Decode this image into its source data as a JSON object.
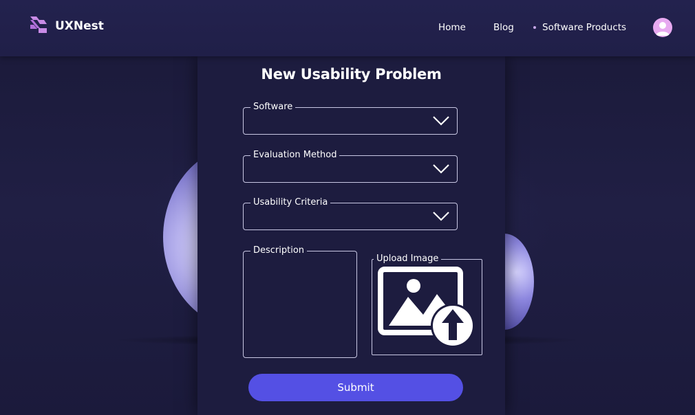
{
  "app": {
    "name": "UXNest"
  },
  "nav": {
    "items": [
      {
        "label": "Home"
      },
      {
        "label": "Blog"
      },
      {
        "label": "Software Products"
      }
    ]
  },
  "form": {
    "title": "New Usability Problem",
    "software_label": "Software",
    "software_value": "",
    "method_label": "Evaluation Method",
    "method_value": "",
    "criteria_label": "Usability Criteria",
    "criteria_value": "",
    "description_label": "Description",
    "description_value": "",
    "upload_label": "Upload Image",
    "submit_label": "Submit"
  },
  "colors": {
    "accent": "#5450e4",
    "background": "#1d1c3f",
    "logo": "#c98be6",
    "avatar": "#e7a9f0"
  },
  "icons": [
    "logo-icon",
    "user-avatar-icon",
    "chevron-down-icon",
    "image-upload-icon"
  ]
}
